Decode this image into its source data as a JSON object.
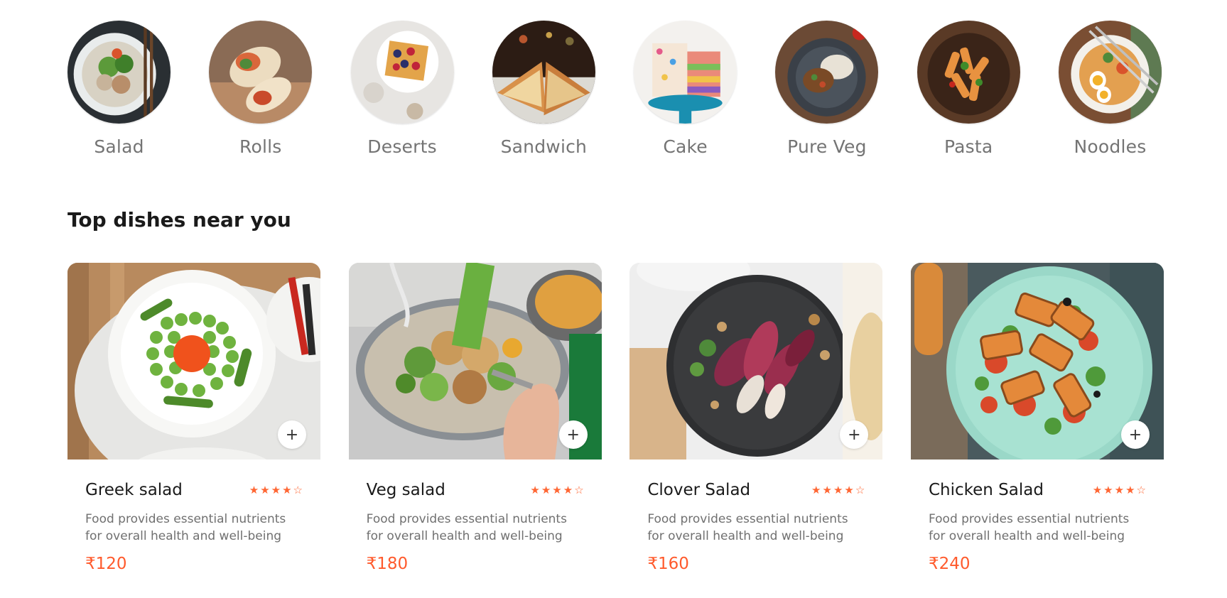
{
  "categories": [
    {
      "label": "Salad",
      "icon": "salad-thumbnail"
    },
    {
      "label": "Rolls",
      "icon": "rolls-thumbnail"
    },
    {
      "label": "Deserts",
      "icon": "deserts-thumbnail"
    },
    {
      "label": "Sandwich",
      "icon": "sandwich-thumbnail"
    },
    {
      "label": "Cake",
      "icon": "cake-thumbnail"
    },
    {
      "label": "Pure Veg",
      "icon": "pure-veg-thumbnail"
    },
    {
      "label": "Pasta",
      "icon": "pasta-thumbnail"
    },
    {
      "label": "Noodles",
      "icon": "noodles-thumbnail"
    }
  ],
  "section": {
    "title": "Top dishes near you"
  },
  "dishes": [
    {
      "name": "Greek salad",
      "rating": 4,
      "rating_max": 5,
      "description": "Food provides essential nutrients for overall health and well-being",
      "price": "₹120",
      "add_label": "+"
    },
    {
      "name": "Veg salad",
      "rating": 4,
      "rating_max": 5,
      "description": "Food provides essential nutrients for overall health and well-being",
      "price": "₹180",
      "add_label": "+"
    },
    {
      "name": "Clover Salad",
      "rating": 4,
      "rating_max": 5,
      "description": "Food provides essential nutrients for overall health and well-being",
      "price": "₹160",
      "add_label": "+"
    },
    {
      "name": "Chicken Salad",
      "rating": 4,
      "rating_max": 5,
      "description": "Food provides essential nutrients for overall health and well-being",
      "price": "₹240",
      "add_label": "+"
    }
  ],
  "colors": {
    "accent": "#ff5a2c",
    "star": "#ff6633",
    "muted_text": "#747474"
  }
}
